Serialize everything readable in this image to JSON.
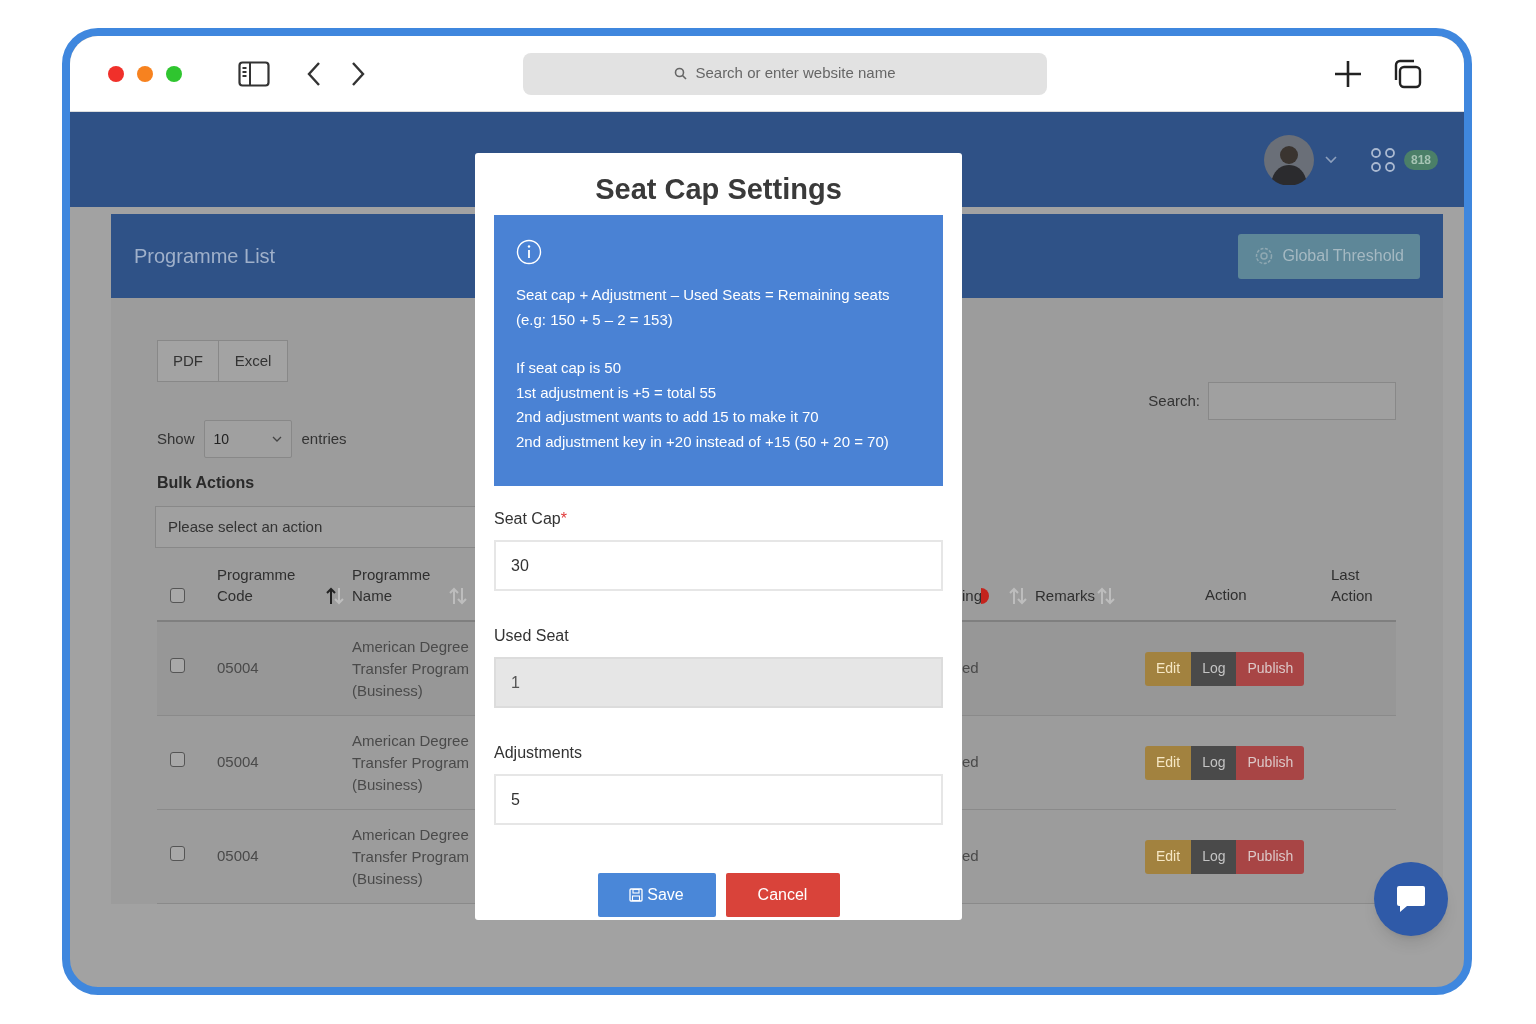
{
  "browser": {
    "address_placeholder": "Search or enter website name"
  },
  "header": {
    "badge": "818"
  },
  "card": {
    "title": "Programme List",
    "button": "Global Threshold"
  },
  "export_buttons": [
    "PDF",
    "Excel"
  ],
  "length_menu": {
    "before": "Show",
    "value": "10",
    "after": "entries"
  },
  "search": {
    "label": "Search:"
  },
  "bulk_actions": {
    "label": "Bulk Actions",
    "placeholder": "Please select an action"
  },
  "table": {
    "select_all_checked": false,
    "columns": [
      {
        "label": "Programme Code",
        "sort_active": true
      },
      {
        "label": "Programme Name",
        "sort_active": false
      },
      {
        "label": "ing",
        "sort_active": false
      },
      {
        "label": "Remarks",
        "sort_active": false
      },
      {
        "label": "Action"
      },
      {
        "label": "Last Action"
      }
    ],
    "rows": [
      {
        "checked": false,
        "code": "05004",
        "name": "American Degree Transfer Program (Business)",
        "column_4": "ed",
        "actions": [
          "Edit",
          "Log",
          "Publish"
        ]
      },
      {
        "checked": false,
        "code": "05004",
        "name": "American Degree Transfer Program (Business)",
        "column_4": "ed",
        "actions": [
          "Edit",
          "Log",
          "Publish"
        ]
      },
      {
        "checked": false,
        "code": "05004",
        "name": "American Degree Transfer Program (Business)",
        "column_4": "ed",
        "actions": [
          "Edit",
          "Log",
          "Publish"
        ]
      }
    ]
  },
  "modal": {
    "title": "Seat Cap Settings",
    "info_paragraphs": [
      [
        "Seat cap + Adjustment – Used Seats = Remaining seats",
        "(e.g: 150 + 5 – 2 = 153)"
      ],
      [
        "If seat cap is 50",
        "1st adjustment is +5 = total 55",
        "2nd adjustment wants to add 15 to make it 70",
        "2nd adjustment key in +20 instead of +15 (50 + 20 = 70)"
      ]
    ],
    "fields": [
      {
        "label": "Seat Cap",
        "required_mark": "*",
        "value": "30",
        "disabled": false
      },
      {
        "label": "Used Seat",
        "value": "1",
        "disabled": true
      },
      {
        "label": "Adjustments",
        "value": "5",
        "disabled": false
      }
    ],
    "save": "Save",
    "cancel": "Cancel"
  }
}
